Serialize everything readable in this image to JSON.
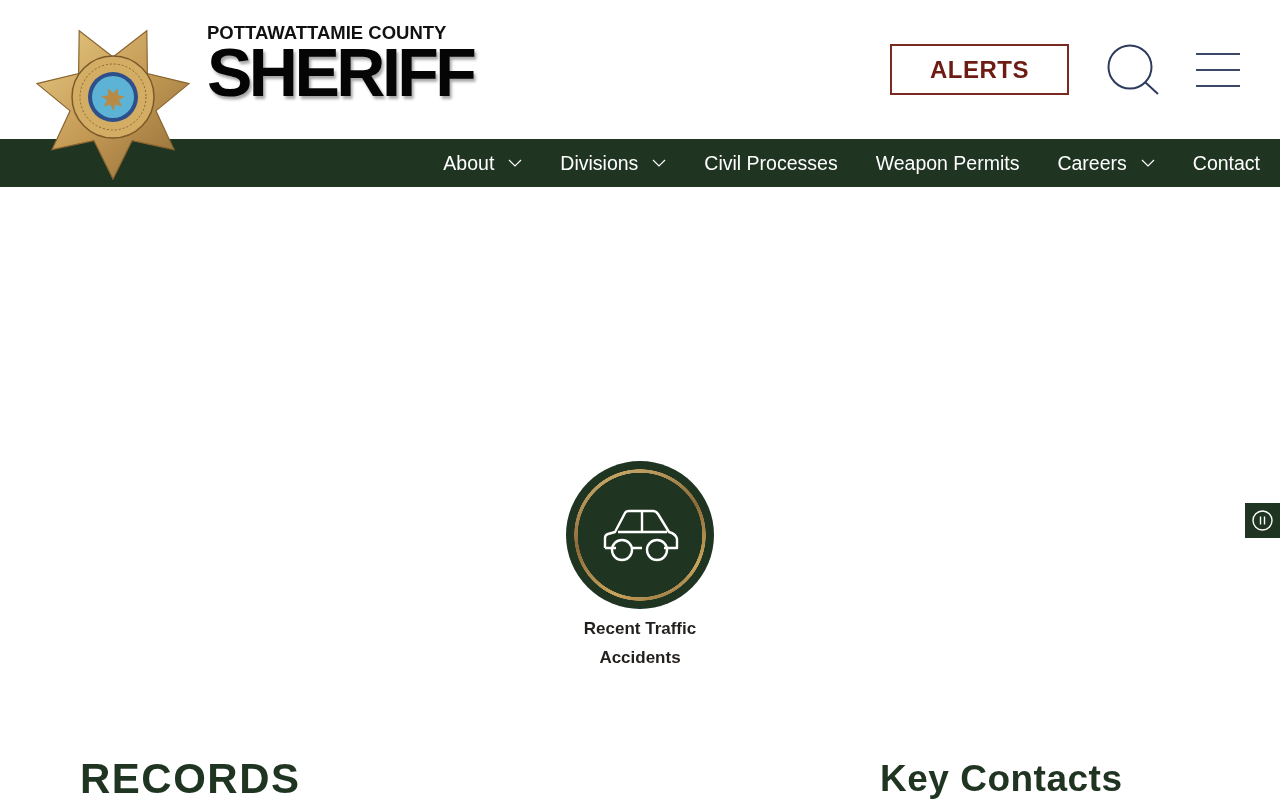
{
  "header": {
    "logo": {
      "subtitle": "POTTAWATTAMIE COUNTY",
      "title": "SHERIFF"
    },
    "alerts_button": {
      "label": "ALERTS"
    }
  },
  "nav": {
    "items": [
      {
        "label": "About",
        "dropdown": true
      },
      {
        "label": "Divisions",
        "dropdown": true
      },
      {
        "label": "Civil Processes",
        "dropdown": false
      },
      {
        "label": "Weapon Permits",
        "dropdown": false
      },
      {
        "label": "Careers",
        "dropdown": true
      },
      {
        "label": "Contact",
        "dropdown": false
      }
    ]
  },
  "quick_links": [
    {
      "label": "Recent Traffic Accidents"
    }
  ],
  "sections": [
    {
      "heading": "RECORDS"
    },
    {
      "heading": "Key Contacts"
    }
  ]
}
